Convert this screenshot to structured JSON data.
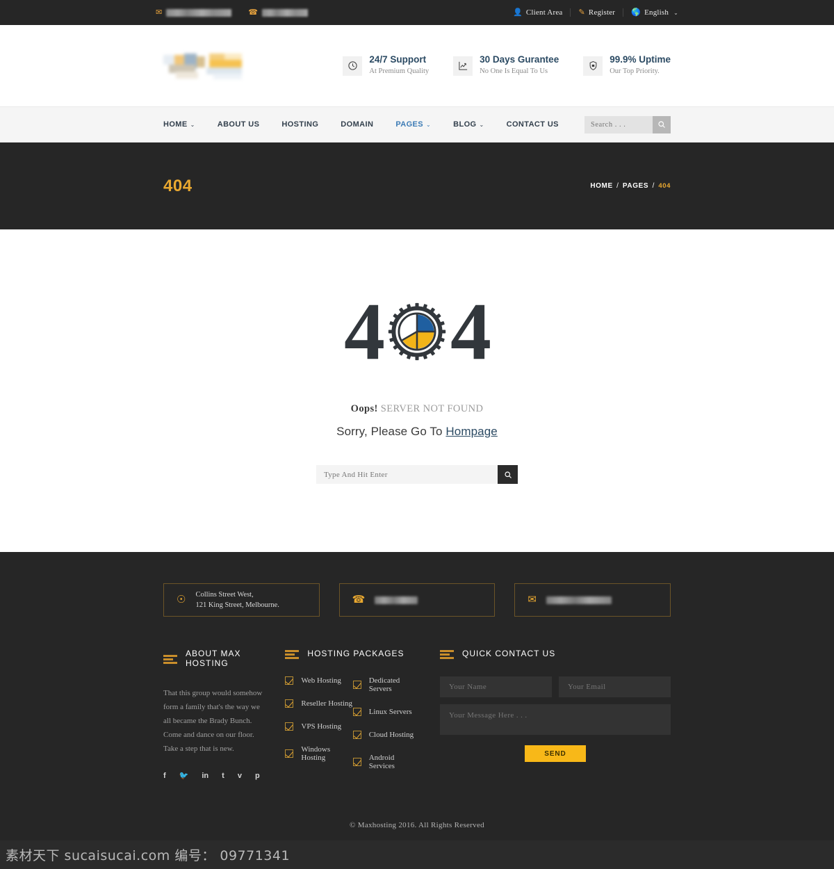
{
  "topbar": {
    "email_redacted": true,
    "phone_redacted": true,
    "links": [
      {
        "label": "Client Area",
        "icon": "user-icon"
      },
      {
        "label": "Register",
        "icon": "pen-icon"
      },
      {
        "label": "English",
        "icon": "globe-icon",
        "caret": "⌄"
      }
    ]
  },
  "header": {
    "logo_alt": "Max Hosting logo (blurred)",
    "features": [
      {
        "icon": "clock-icon",
        "title": "24/7 Support",
        "sub": "At Premium Quality"
      },
      {
        "icon": "chart-up-icon",
        "title": "30 Days Gurantee",
        "sub": "No One Is Equal To Us"
      },
      {
        "icon": "shield-lock-icon",
        "title": "99.9% Uptime",
        "sub": "Our Top Priority."
      }
    ]
  },
  "nav": {
    "items": [
      {
        "label": "HOME",
        "caret": "⌄",
        "active": false
      },
      {
        "label": "ABOUT US",
        "caret": "",
        "active": false
      },
      {
        "label": "HOSTING",
        "caret": "",
        "active": false
      },
      {
        "label": "DOMAIN",
        "caret": "",
        "active": false
      },
      {
        "label": "PAGES",
        "caret": "⌄",
        "active": true
      },
      {
        "label": "BLOG",
        "caret": "⌄",
        "active": false
      },
      {
        "label": "CONTACT US",
        "caret": "",
        "active": false
      }
    ],
    "search_placeholder": "Search . . ."
  },
  "banner": {
    "title": "404",
    "breadcrumb": {
      "home": "HOME",
      "section": "PAGES",
      "current": "404",
      "separator": "/"
    }
  },
  "main": {
    "digit_left": "4",
    "digit_right": "4",
    "gear_icon": "gear-pie-icon",
    "oops_bold": "Oops!",
    "oops_rest": "SERVER NOT FOUND",
    "sorry_prefix": "Sorry, Please Go To ",
    "sorry_link": "Hompage",
    "search_placeholder": "Type And Hit Enter"
  },
  "footer": {
    "contact_boxes": [
      {
        "icon": "map-pin-icon",
        "line1": "Collins Street West,",
        "line2": "121 King Street, Melbourne.",
        "redacted": false
      },
      {
        "icon": "phone-icon",
        "redacted": true
      },
      {
        "icon": "envelope-icon",
        "redacted": true
      }
    ],
    "about": {
      "heading": "ABOUT MAX HOSTING",
      "paragraph": "That this group would somehow form a family that's the way we all became the Brady Bunch. Come and dance on our floor. Take a step that is new.",
      "socials": [
        {
          "name": "facebook-icon",
          "glyph": "f"
        },
        {
          "name": "twitter-icon",
          "glyph": "🐦"
        },
        {
          "name": "linkedin-icon",
          "glyph": "in"
        },
        {
          "name": "tumblr-icon",
          "glyph": "t"
        },
        {
          "name": "vimeo-icon",
          "glyph": "v"
        },
        {
          "name": "pinterest-icon",
          "glyph": "p"
        }
      ]
    },
    "packages": {
      "heading": "HOSTING PACKAGES",
      "col1": [
        "Web Hosting",
        "Reseller Hosting",
        "VPS Hosting",
        "Windows Hosting"
      ],
      "col2": [
        "Dedicated Servers",
        "Linux Servers",
        "Cloud Hosting",
        "Android Services"
      ]
    },
    "contact_form": {
      "heading": "QUICK CONTACT US",
      "name_placeholder": "Your Name",
      "email_placeholder": "Your Email",
      "message_placeholder": "Your Message Here . . .",
      "send_label": "SEND"
    },
    "copyright": "© Maxhosting 2016.  All Rights Reserved"
  },
  "watermark": {
    "text": "素材天下 sucaisucai.com  编号： 09771341"
  },
  "colors": {
    "accent_amber": "#e9a830",
    "send_yellow": "#f8b818",
    "dark": "#262626",
    "link_blue": "#2b4a63",
    "nav_active": "#3c7bb5"
  }
}
